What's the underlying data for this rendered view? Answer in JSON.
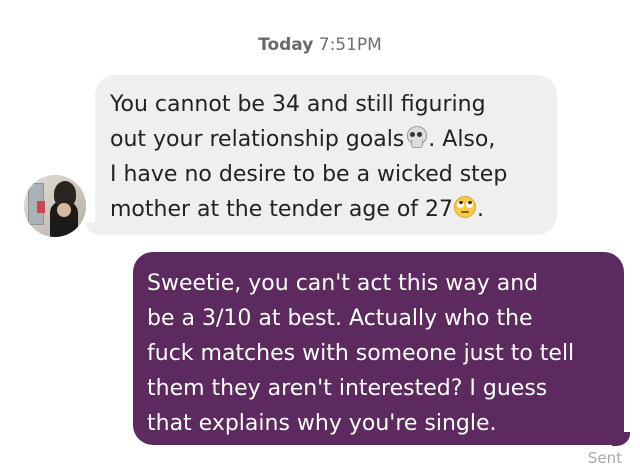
{
  "header": {
    "day": "Today",
    "time": "7:51PM"
  },
  "conversation": {
    "received": {
      "avatar_icon": "profile-photo",
      "text_part1": "You cannot be 34 and still figuring\nout your relationship goals",
      "emoji1": "skull-icon",
      "text_part2": ". Also,\nI have no desire to be a wicked step\nmother at the tender age of 27",
      "emoji2": "face-with-rolling-eyes-icon",
      "text_part3": "."
    },
    "sent": {
      "text": "Sweetie, you can't act this way and\nbe a 3/10 at best. Actually who the\nfuck matches with someone just to tell\nthem they aren't interested? I guess\nthat explains why you're single.",
      "status": "Sent"
    }
  },
  "colors": {
    "sent_bubble": "#5c2a5e",
    "received_bubble": "#efefef",
    "status_text": "#a9a9a9"
  }
}
